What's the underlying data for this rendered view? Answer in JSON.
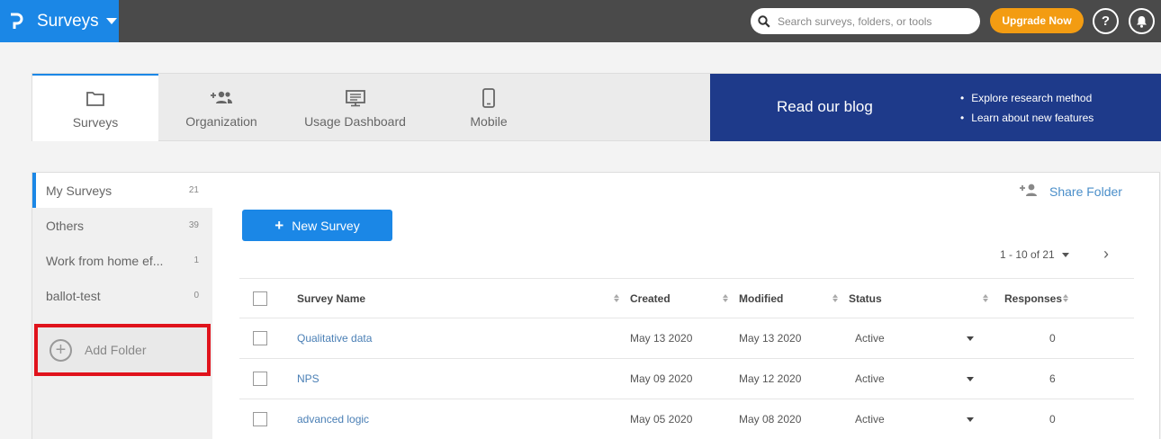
{
  "topbar": {
    "brand_title": "Surveys",
    "search_placeholder": "Search surveys, folders, or tools",
    "upgrade_label": "Upgrade Now",
    "help_label": "?"
  },
  "nav": {
    "tabs": [
      {
        "label": "Surveys",
        "icon": "folder-icon"
      },
      {
        "label": "Organization",
        "icon": "add-group-icon"
      },
      {
        "label": "Usage Dashboard",
        "icon": "dashboard-icon"
      },
      {
        "label": "Mobile",
        "icon": "mobile-icon"
      }
    ],
    "blog": {
      "heading": "Read our blog",
      "bullets": [
        "Explore research method",
        "Learn about new features"
      ]
    }
  },
  "sidebar": {
    "folders": [
      {
        "name": "My Surveys",
        "count": "21"
      },
      {
        "name": "Others",
        "count": "39"
      },
      {
        "name": "Work from home ef...",
        "count": "1"
      },
      {
        "name": "ballot-test",
        "count": "0"
      }
    ],
    "add_folder_label": "Add Folder"
  },
  "content": {
    "share_label": "Share Folder",
    "new_survey_label": "New Survey",
    "new_survey_plus": "+",
    "pager_text": "1 - 10 of 21",
    "next_glyph": "›"
  },
  "table": {
    "headers": {
      "name": "Survey Name",
      "created": "Created",
      "modified": "Modified",
      "status": "Status",
      "responses": "Responses"
    },
    "rows": [
      {
        "name": "Qualitative data",
        "created": "May 13 2020",
        "modified": "May 13 2020",
        "status": "Active",
        "responses": "0"
      },
      {
        "name": "NPS",
        "created": "May 09 2020",
        "modified": "May 12 2020",
        "status": "Active",
        "responses": "6"
      },
      {
        "name": "advanced logic",
        "created": "May 05 2020",
        "modified": "May 08 2020",
        "status": "Active",
        "responses": "0"
      }
    ]
  },
  "colors": {
    "brand_blue": "#1b87e6",
    "upgrade_orange": "#f39c12",
    "blog_navy": "#1e3a8a",
    "highlight_red": "#e0131c"
  }
}
